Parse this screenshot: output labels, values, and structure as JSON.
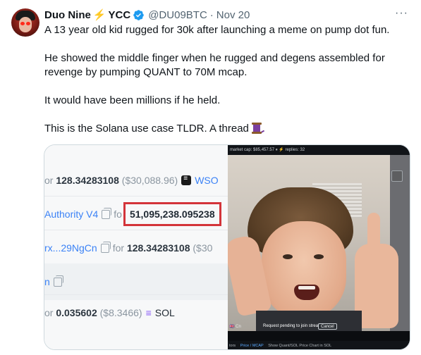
{
  "tweet": {
    "author_name": "Duo Nine",
    "author_suffix": "YCC",
    "handle": "@DU09BTC",
    "date": "Nov 20",
    "paragraphs": [
      "A 13 year old kid rugged for 30k after launching a meme on pump dot fun.",
      "He showed the middle finger when he rugged and degens assembled for revenge by pumping QUANT to 70M mcap.",
      "It would have been millions if he held.",
      "This is the Solana use case TLDR. A thread"
    ],
    "icons": [
      "lightning-icon",
      "verified-badge-icon",
      "more-icon",
      "spool-emoji-icon"
    ],
    "colors": {
      "accent": "#1d9bf0",
      "highlight_box": "#d3343a",
      "lightning": "#f4b400"
    }
  },
  "left_image": {
    "row1": {
      "prefix": "or",
      "amount": "128.34283108",
      "usd": "($30,088.96)",
      "token": "WSO"
    },
    "row2": {
      "label": "Authority V4",
      "for": "fo",
      "amount": "51,095,238.095238"
    },
    "row3": {
      "label": "rx...29NgCn",
      "for": "for",
      "amount": "128.34283108",
      "usd": "($30"
    },
    "row4": {
      "label": "n"
    },
    "row5": {
      "prefix": "or",
      "amount": "0.035602",
      "usd": "($8.3466)",
      "token": "SOL"
    }
  },
  "right_image": {
    "top_bar": "market cap: $85,457.57  ⏸ ⚡    replies: 32",
    "corner_label": "🇬🇧 Cn",
    "request_text": "Request pending to join stream",
    "cancel_label": "Cancel",
    "bottom_bar": [
      "tors",
      "Price / MCAP",
      "Show Quant/SOL Price Chart in SOL"
    ]
  }
}
